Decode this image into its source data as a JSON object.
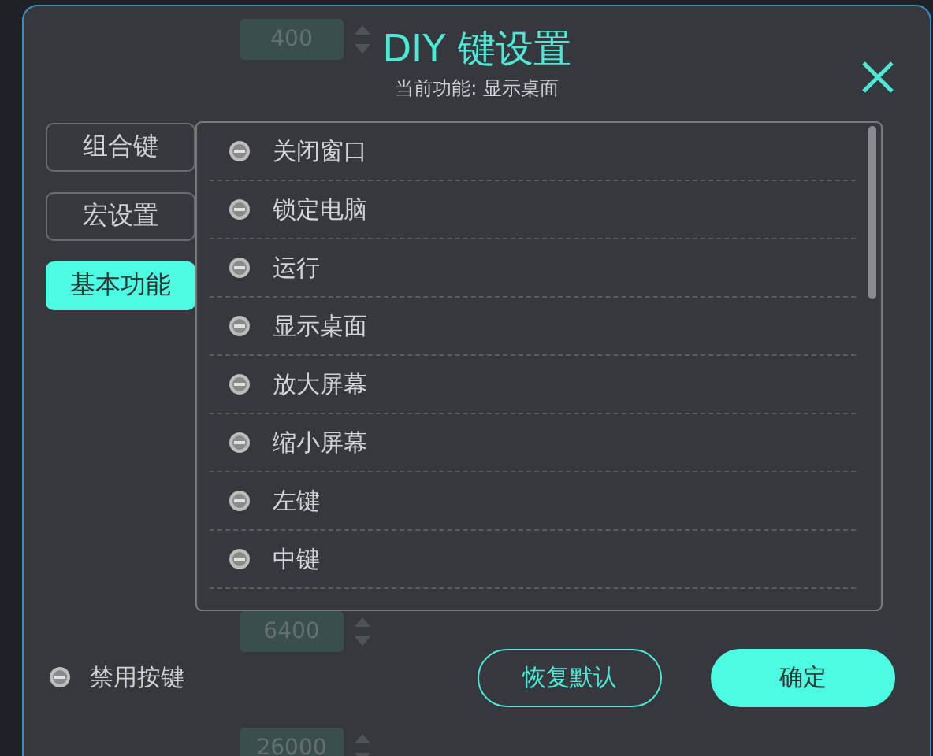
{
  "background_fields": [
    {
      "value": "400"
    },
    {
      "value": "6400"
    },
    {
      "value": "26000"
    }
  ],
  "dialog": {
    "title": "DIY 键设置",
    "subtitle": "当前功能: 显示桌面"
  },
  "tabs": [
    {
      "label": "组合键",
      "selected": false
    },
    {
      "label": "宏设置",
      "selected": false
    },
    {
      "label": "基本功能",
      "selected": true
    }
  ],
  "functions": [
    {
      "label": "关闭窗口"
    },
    {
      "label": "锁定电脑"
    },
    {
      "label": "运行"
    },
    {
      "label": "显示桌面"
    },
    {
      "label": "放大屏幕"
    },
    {
      "label": "缩小屏幕"
    },
    {
      "label": "左键"
    },
    {
      "label": "中键"
    }
  ],
  "disable_key": {
    "label": "禁用按键"
  },
  "buttons": [
    {
      "label": "恢复默认",
      "kind": "outline"
    },
    {
      "label": "确定",
      "kind": "primary"
    }
  ]
}
